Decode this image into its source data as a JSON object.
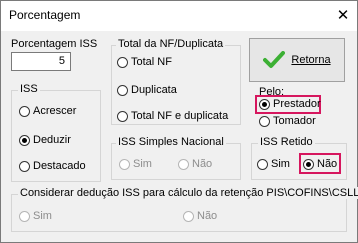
{
  "window": {
    "title": "Porcentagem",
    "close_glyph": "✕"
  },
  "porcentagem_iss": {
    "label": "Porcentagem ISS",
    "value": "5"
  },
  "total_group": {
    "title": "Total da NF/Duplicata",
    "options": [
      "Total NF",
      "Duplicata",
      "Total NF e duplicata"
    ],
    "selected": null
  },
  "retorna_button": {
    "label": "Retorna",
    "icon": "check-icon",
    "icon_color": "#3cb034"
  },
  "pelo": {
    "label": "Pelo:",
    "options": [
      "Prestador",
      "Tomador"
    ],
    "selected": "Prestador"
  },
  "iss_group": {
    "title": "ISS",
    "options": [
      "Acrescer",
      "Deduzir",
      "Destacado"
    ],
    "selected": "Deduzir"
  },
  "iss_simples_group": {
    "title": "ISS Simples Nacional",
    "options": [
      "Sim",
      "Não"
    ],
    "selected": null,
    "enabled": false
  },
  "iss_retido_group": {
    "title": "ISS Retido",
    "options": [
      "Sim",
      "Não"
    ],
    "selected": "Não"
  },
  "deducao_group": {
    "title": "Considerar dedução ISS para cálculo da retenção PIS\\COFINS\\CSLL",
    "options": [
      "Sim",
      "Não"
    ],
    "selected": null,
    "enabled": false
  },
  "colors": {
    "highlight": "#d6165e",
    "window_bg": "#f0f0f0"
  }
}
